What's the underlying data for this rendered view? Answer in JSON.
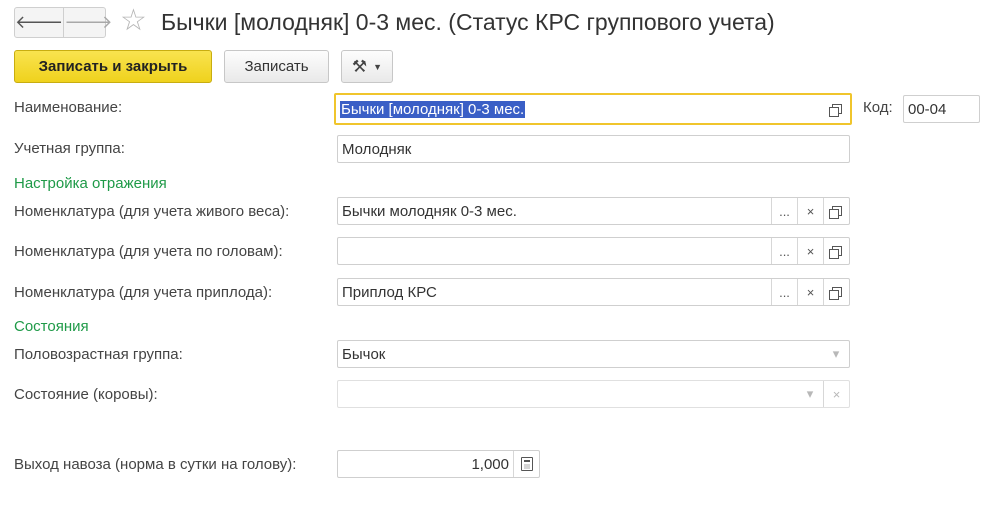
{
  "header": {
    "back_icon": "arrow-left-icon",
    "forward_icon": "arrow-right-icon",
    "favorite_icon": "star-outline-icon",
    "title": "Бычки [молодняк] 0-3 мес. (Статус КРС группового учета)"
  },
  "toolbar": {
    "save_close_label": "Записать и закрыть",
    "save_label": "Записать",
    "more_icon": "tools-icon",
    "accent_color": "#f4d92f"
  },
  "form": {
    "name": {
      "label": "Наименование:",
      "value": "Бычки [молодняк] 0-3 мес."
    },
    "code": {
      "label": "Код:",
      "value": "00-04"
    },
    "account_group": {
      "label": "Учетная группа:",
      "value": "Молодняк"
    },
    "section_reflection": "Настройка отражения",
    "nomenclature_live_weight": {
      "label": "Номенклатура (для учета живого веса):",
      "value": "Бычки молодняк 0-3 мес."
    },
    "nomenclature_heads": {
      "label": "Номенклатура (для учета по головам):",
      "value": ""
    },
    "nomenclature_offspring": {
      "label": "Номенклатура (для учета приплода):",
      "value": "Приплод КРС"
    },
    "section_states": "Состояния",
    "sex_age_group": {
      "label": "Половозрастная группа:",
      "value": "Бычок"
    },
    "cow_state": {
      "label": "Состояние (коровы):",
      "value": ""
    },
    "manure_output": {
      "label": "Выход навоза (норма в сутки на голову):",
      "value": "1,000"
    },
    "section_color": "#1f9a48",
    "focus_color": "#f0c52c"
  },
  "glyphs": {
    "ellipsis": "...",
    "clear": "×",
    "dropdown": "▾"
  }
}
